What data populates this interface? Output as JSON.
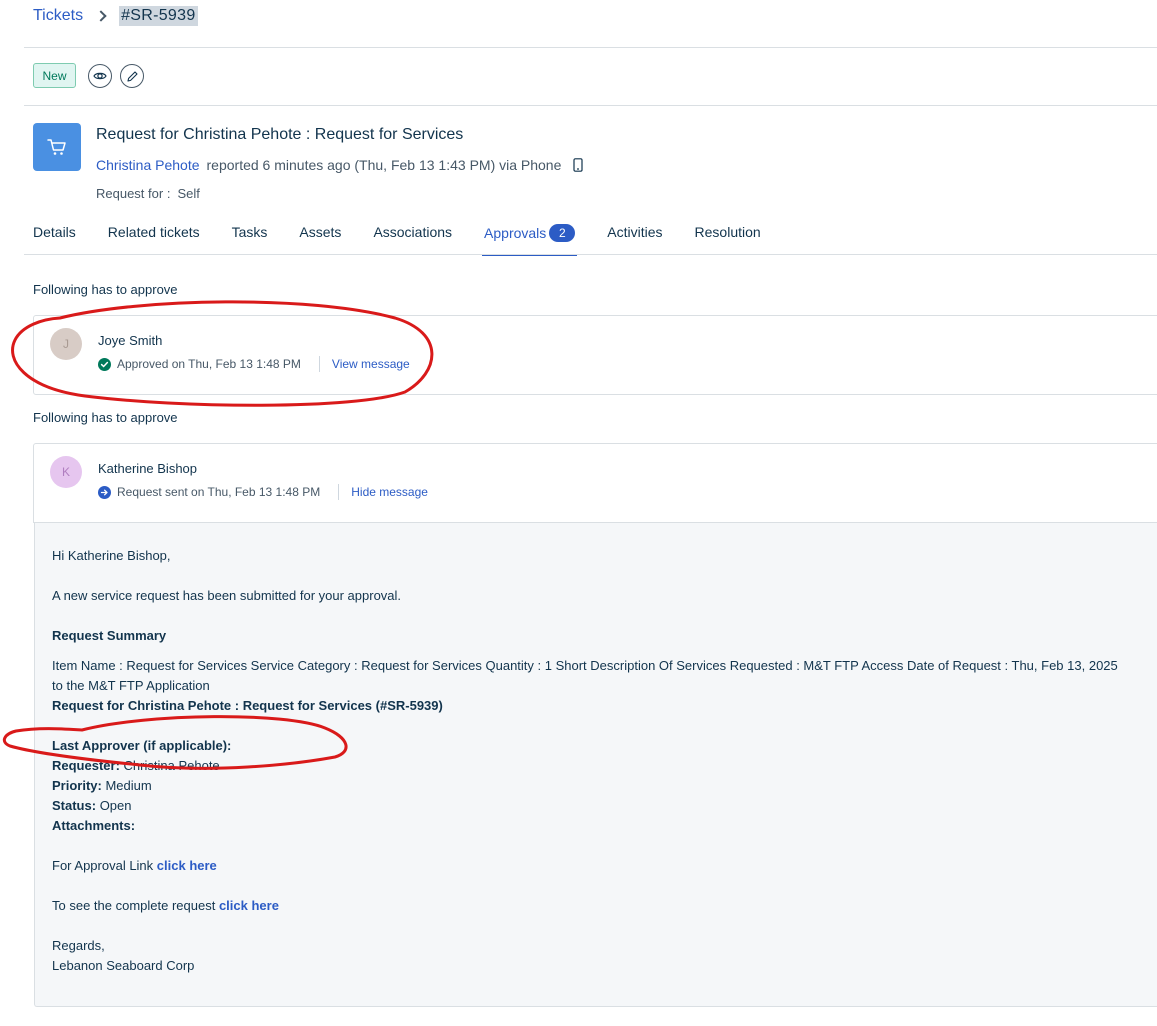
{
  "breadcrumb": {
    "root": "Tickets",
    "current": "#SR-5939"
  },
  "status_badge": "New",
  "icons": {
    "watch": "eye-icon",
    "edit": "pencil-icon",
    "ticket_type": "shopping-cart-icon",
    "source": "mobile-phone-icon"
  },
  "ticket": {
    "title": "Request for Christina Pehote : Request for Services",
    "requester": "Christina Pehote",
    "reported_text": "reported 6 minutes ago (Thu, Feb 13 1:43 PM) via Phone",
    "request_for_label": "Request for :",
    "request_for_value": "Self"
  },
  "tabs": [
    {
      "label": "Details"
    },
    {
      "label": "Related tickets"
    },
    {
      "label": "Tasks"
    },
    {
      "label": "Assets"
    },
    {
      "label": "Associations"
    },
    {
      "label": "Approvals",
      "count": "2",
      "active": true
    },
    {
      "label": "Activities"
    },
    {
      "label": "Resolution"
    }
  ],
  "approvals": [
    {
      "heading": "Following has to approve",
      "initial": "J",
      "name": "Joye Smith",
      "status": "Approved on Thu, Feb 13 1:48 PM",
      "link": "View message",
      "status_color": "#00795b"
    },
    {
      "heading": "Following has to approve",
      "initial": "K",
      "name": "Katherine Bishop",
      "status": "Request sent on Thu, Feb 13 1:48 PM",
      "link": "Hide message",
      "status_color": "#2c5cc5"
    }
  ],
  "message": {
    "greeting": "Hi Katherine Bishop,",
    "intro": "A new service request has been submitted for your approval.",
    "summary_heading": "Request Summary",
    "summary_line1": "Item Name : Request for Services Service Category : Request for Services Quantity : 1 Short Description Of Services Requested : M&T FTP Access Date of Request : Thu, Feb 13, 2025",
    "summary_line2": "to the M&T FTP Application",
    "request_ref": "Request for Christina Pehote : Request for Services (#SR-5939)",
    "last_approver_label": "Last Approver (if applicable):",
    "requester_label": "Requester:",
    "requester_value": "Christina Pehote",
    "priority_label": "Priority:",
    "priority_value": "Medium",
    "status_label": "Status:",
    "status_value": "Open",
    "attachments_label": "Attachments:",
    "approval_link_text": "For Approval Link",
    "approval_link_label": "click here",
    "complete_request_text": "To see the complete request",
    "complete_request_label": "click here",
    "regards": "Regards,",
    "company": "Lebanon Seaboard Corp"
  },
  "colors": {
    "accent": "#2c5cc5",
    "annotation": "#d91a1a",
    "approved": "#00795b"
  }
}
